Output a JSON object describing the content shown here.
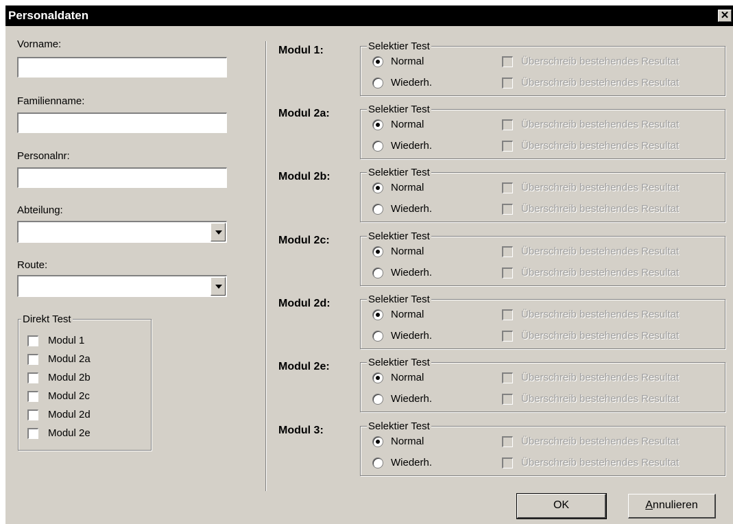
{
  "window": {
    "title": "Personaldaten",
    "close_glyph": "✕"
  },
  "fields": {
    "vorname": {
      "label": "Vorname:",
      "value": ""
    },
    "familienname": {
      "label": "Familienname:",
      "value": ""
    },
    "personalnr": {
      "label": "Personalnr:",
      "value": ""
    },
    "abteilung": {
      "label": "Abteilung:",
      "value": ""
    },
    "route": {
      "label": "Route:",
      "value": ""
    }
  },
  "direkt_test": {
    "title": "Direkt Test",
    "items": [
      "Modul 1",
      "Modul 2a",
      "Modul 2b",
      "Modul 2c",
      "Modul 2d",
      "Modul 2e"
    ]
  },
  "modules": [
    {
      "label": "Modul 1:"
    },
    {
      "label": "Modul 2a:"
    },
    {
      "label": "Modul 2b:"
    },
    {
      "label": "Modul 2c:"
    },
    {
      "label": "Modul 2d:"
    },
    {
      "label": "Modul 2e:"
    },
    {
      "label": "Modul 3:"
    }
  ],
  "selection": {
    "group_title": "Selektier Test",
    "normal": "Normal",
    "repeat": "Wiederh.",
    "overwrite": "Überschreib bestehendes Resultat",
    "selected": "Normal"
  },
  "buttons": {
    "ok": "OK",
    "cancel": "Annulieren"
  }
}
